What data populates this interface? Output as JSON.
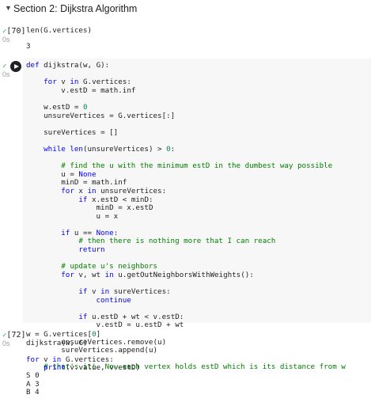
{
  "section": {
    "title": "Section 2: Dijkstra Algorithm"
  },
  "cells": [
    {
      "exec": "[70]",
      "time": "0s",
      "code": [
        "len(G.vertices)"
      ],
      "output": [
        "3"
      ]
    },
    {
      "exec": "",
      "time": "0s",
      "code": [
        "def dijkstra(w, G):",
        "",
        "    for v in G.vertices:",
        "        v.estD = math.inf",
        "",
        "    w.estD = 0",
        "    unsureVertices = G.vertices[:]",
        "",
        "    sureVertices = []",
        "",
        "    while len(unsureVertices) > 0:",
        "",
        "        # find the u with the minimum estD in the dumbest way possible",
        "        u = None",
        "        minD = math.inf",
        "        for x in unsureVertices:",
        "            if x.estD < minD:",
        "                minD = x.estD",
        "                u = x",
        "",
        "        if u == None:",
        "            # then there is nothing more that I can reach",
        "            return",
        "",
        "        # update u's neighbors",
        "        for v, wt in u.getOutNeighborsWithWeights():",
        "",
        "            if v in sureVertices:",
        "                continue",
        "",
        "            if u.estD + wt < v.estD:",
        "                v.estD = u.estD + wt",
        "",
        "        unsureVertices.remove(u)",
        "        sureVertices.append(u)",
        "",
        "    # that's it!  Now each vertex holds estD which is its distance from w"
      ],
      "output": []
    },
    {
      "exec": "[72]",
      "time": "0s",
      "code": [
        "w = G.vertices[0]",
        "dijkstra(w, G)",
        "",
        "for v in G.vertices:",
        "    print(v.value, v.estD)"
      ],
      "output": [
        "S 0",
        "A 3",
        "B 4"
      ]
    }
  ],
  "icons": {
    "check": "check-icon",
    "run": "play-run-icon",
    "caret": "caret-down-icon"
  },
  "colors": {
    "keyword": "#0000ff",
    "comment": "#008000",
    "number": "#098658",
    "success": "#34a853"
  }
}
